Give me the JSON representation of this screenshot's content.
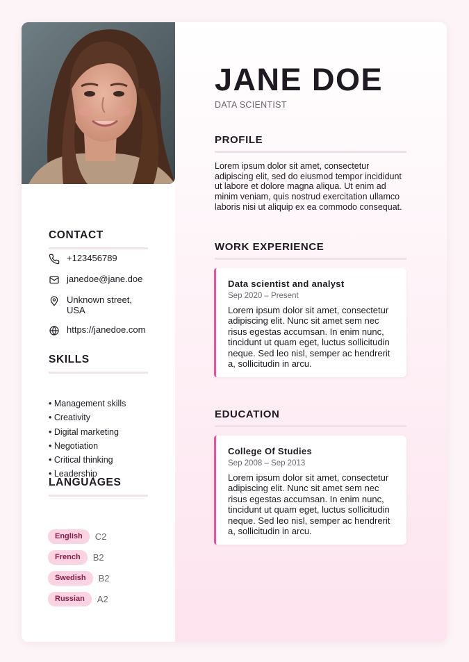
{
  "header": {
    "name": "JANE DOE",
    "title": "DATA SCIENTIST"
  },
  "contact": {
    "heading": "CONTACT",
    "items": [
      {
        "icon": "phone-icon",
        "text": "+123456789"
      },
      {
        "icon": "mail-icon",
        "text": "janedoe@jane.doe"
      },
      {
        "icon": "location-pin-icon",
        "text": "Unknown street, USA"
      },
      {
        "icon": "globe-icon",
        "text": "https://janedoe.com"
      }
    ]
  },
  "skills": {
    "heading": "SKILLS",
    "items": [
      "• Management skills",
      "• Creativity",
      "• Digital marketing",
      "• Negotiation",
      "• Critical thinking",
      "• Leadership"
    ]
  },
  "languages": {
    "heading": "LANGUAGES",
    "items": [
      {
        "name": "English",
        "level": "C2"
      },
      {
        "name": "French",
        "level": "B2"
      },
      {
        "name": "Swedish",
        "level": "B2"
      },
      {
        "name": "Russian",
        "level": "A2"
      }
    ]
  },
  "profile": {
    "heading": "PROFILE",
    "text": "Lorem ipsum dolor sit amet, consectetur adipiscing elit, sed do eiusmod tempor incididunt ut labore et dolore magna aliqua. Ut enim ad minim veniam, quis nostrud exercitation ullamco laboris nisi ut aliquip ex ea commodo consequat."
  },
  "experience": {
    "heading": "WORK EXPERIENCE",
    "entries": [
      {
        "title": "Data scientist and analyst",
        "date": "Sep 2020 – Present",
        "text": "Lorem ipsum dolor sit amet, consectetur adipiscing elit. Nunc sit amet sem nec risus egestas accumsan. In enim nunc, tincidunt ut quam eget, luctus sollicitudin neque. Sed leo nisl, semper ac hendrerit a, sollicitudin in arcu."
      }
    ]
  },
  "education": {
    "heading": "EDUCATION",
    "entries": [
      {
        "title": "College Of Studies",
        "date": "Sep 2008 – Sep 2013",
        "text": "Lorem ipsum dolor sit amet, consectetur adipiscing elit. Nunc sit amet sem nec risus egestas accumsan. In enim nunc, tincidunt ut quam eget, luctus sollicitudin neque. Sed leo nisl, semper ac hendrerit a, sollicitudin in arcu."
      }
    ]
  },
  "colors": {
    "accent": "#e8559a",
    "pill_bg": "#fbd3e2",
    "pill_text": "#8c1d4a",
    "main_bg_bottom": "#fde3ee"
  }
}
